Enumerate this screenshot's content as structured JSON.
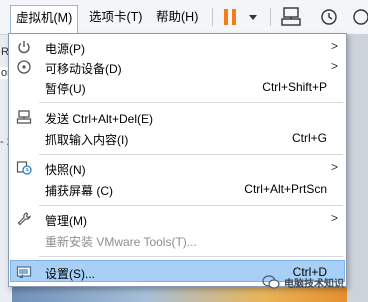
{
  "menubar": {
    "items": [
      {
        "label": "虚拟机(M)"
      },
      {
        "label": "选项卡(T)"
      },
      {
        "label": "帮助(H)"
      }
    ]
  },
  "background": {
    "fragments": [
      "R",
      "osc",
      "- 2"
    ]
  },
  "menu": {
    "items": [
      {
        "label": "电源(P)",
        "shortcut": "",
        "submenu": ">",
        "icon": "power-icon"
      },
      {
        "label": "可移动设备(D)",
        "shortcut": "",
        "submenu": ">",
        "icon": "removable-device-icon"
      },
      {
        "label": "暂停(U)",
        "shortcut": "Ctrl+Shift+P",
        "submenu": "",
        "icon": ""
      },
      {
        "label": "发送 Ctrl+Alt+Del(E)",
        "shortcut": "",
        "submenu": "",
        "icon": "keyboard-send-icon"
      },
      {
        "label": "抓取输入内容(I)",
        "shortcut": "Ctrl+G",
        "submenu": "",
        "icon": ""
      },
      {
        "label": "快照(N)",
        "shortcut": "",
        "submenu": ">",
        "icon": "snapshot-icon"
      },
      {
        "label": "捕获屏幕 (C)",
        "shortcut": "Ctrl+Alt+PrtScn",
        "submenu": "",
        "icon": ""
      },
      {
        "label": "管理(M)",
        "shortcut": "",
        "submenu": ">",
        "icon": "wrench-icon"
      },
      {
        "label": "重新安装 VMware Tools(T)...",
        "shortcut": "",
        "submenu": "",
        "icon": ""
      },
      {
        "label": "设置(S)...",
        "shortcut": "Ctrl+D",
        "submenu": "",
        "icon": "settings-icon"
      }
    ]
  },
  "watermark": {
    "text": "电脑技术知识"
  },
  "colors": {
    "highlight": "#a8d0f7",
    "pause_orange": "#f07f1a",
    "menu_border": "#8a9bb0"
  }
}
